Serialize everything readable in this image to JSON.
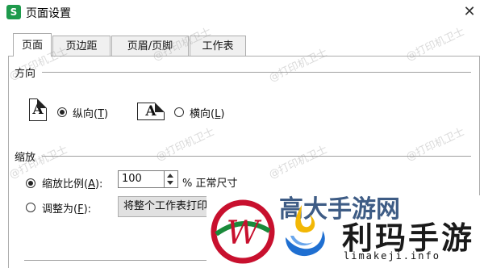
{
  "window": {
    "icon_letter": "S",
    "title": "页面设置",
    "close_glyph": "✕"
  },
  "tabs": [
    {
      "label": "页面",
      "active": true
    },
    {
      "label": "页边距",
      "active": false
    },
    {
      "label": "页眉/页脚",
      "active": false
    },
    {
      "label": "工作表",
      "active": false
    }
  ],
  "orientation": {
    "group_label": "方向",
    "portrait_label": "纵向(",
    "portrait_key": "T",
    "landscape_label": "横向(",
    "landscape_key": "L",
    "selected": "portrait",
    "page_glyph": "A"
  },
  "scaling": {
    "group_label": "缩放",
    "scale_label": "缩放比例(",
    "scale_key": "A",
    "scale_value": "100",
    "scale_suffix": "% 正常尺寸",
    "fit_label": "调整为(",
    "fit_key": "F",
    "fit_select_value": "将整个工作表打印",
    "selected": "scale"
  },
  "watermark": {
    "text": "@打印机卫士"
  },
  "overlay": {
    "peek_text": "高大手游网",
    "brand_name": "利玛手游",
    "brand_domain": "limakeji.info"
  },
  "colors": {
    "app_icon": "#1e9a4c",
    "logo_red": "#c8102e",
    "logo_green": "#1a8a3a",
    "logo_blue": "#1f6fd1",
    "logo_yellow": "#f2b705"
  }
}
